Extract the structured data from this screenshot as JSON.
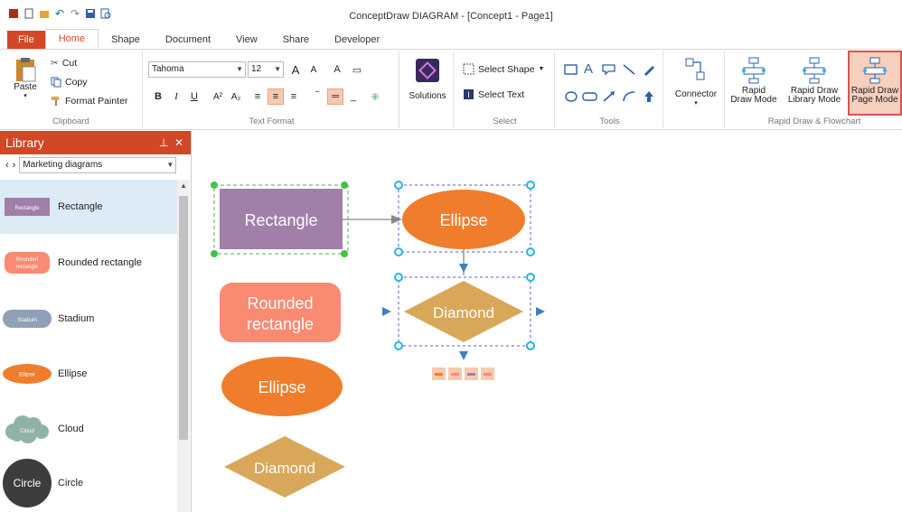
{
  "window": {
    "title": "ConceptDraw DIAGRAM - [Concept1 - Page1]"
  },
  "quick_access": [
    "app-icon",
    "new-icon",
    "open-icon",
    "undo-icon",
    "redo-icon",
    "save-icon",
    "print-preview-icon"
  ],
  "tabs": [
    {
      "label": "File"
    },
    {
      "label": "Home"
    },
    {
      "label": "Shape"
    },
    {
      "label": "Document"
    },
    {
      "label": "View"
    },
    {
      "label": "Share"
    },
    {
      "label": "Developer"
    }
  ],
  "ribbon": {
    "clipboard": {
      "paste": "Paste",
      "cut": "Cut",
      "copy": "Copy",
      "format_painter": "Format Painter",
      "label": "Clipboard"
    },
    "text_format": {
      "font": "Tahoma",
      "size": "12",
      "grow": "A",
      "shrink": "A",
      "clear": "A",
      "label": "Text Format"
    },
    "solutions": {
      "label": "Solutions"
    },
    "select": {
      "select_shape": "Select Shape",
      "select_text": "Select Text",
      "label": "Select"
    },
    "tools": {
      "label": "Tools"
    },
    "connector": {
      "label": "Connector"
    },
    "rapid": {
      "draw_mode_1": "Rapid",
      "draw_mode_2": "Draw Mode",
      "library_mode_1": "Rapid Draw",
      "library_mode_2": "Library Mode",
      "page_mode_1": "Rapid Draw",
      "page_mode_2": "Page Mode",
      "label": "Rapid Draw & Flowchart"
    }
  },
  "library": {
    "title": "Library",
    "selected": "Marketing diagrams",
    "items": [
      {
        "label": "Rectangle",
        "thumb": "Rectangle"
      },
      {
        "label": "Rounded rectangle",
        "thumb_1": "Rounded",
        "thumb_2": "rectangle"
      },
      {
        "label": "Stadium",
        "thumb": "Stadium"
      },
      {
        "label": "Ellipse",
        "thumb": "Ellipse"
      },
      {
        "label": "Cloud",
        "thumb": "Cloud"
      },
      {
        "label": "Circle",
        "thumb": "Circle"
      }
    ]
  },
  "canvas": {
    "shapes": {
      "rectangle": "Rectangle",
      "ellipse_top": "Ellipse",
      "diamond_top": "Diamond",
      "rounded_1": "Rounded",
      "rounded_2": "rectangle",
      "ellipse_bottom": "Ellipse",
      "diamond_bottom": "Diamond"
    }
  },
  "colors": {
    "accent": "#d24726",
    "rectangle": "#a07fa9",
    "rounded": "#fa8a72",
    "ellipse": "#f07d2b",
    "diamond": "#d9a75a",
    "stadium": "#8fa0b7",
    "cloud": "#8fb3a7",
    "circle": "#3d3d3d",
    "selection": "#23b4e8"
  }
}
